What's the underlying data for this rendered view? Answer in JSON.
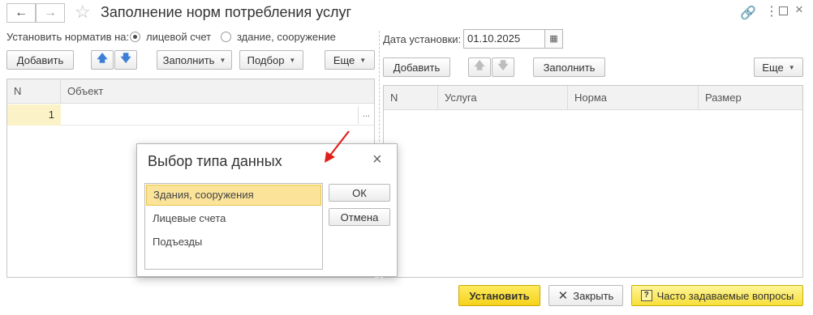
{
  "header": {
    "title": "Заполнение норм потребления услуг"
  },
  "left": {
    "set_label": "Установить норматив на:",
    "radio_account": "лицевой счет",
    "radio_building": "здание, сооружение",
    "add": "Добавить",
    "fill": "Заполнить",
    "pick": "Подбор",
    "more": "Еще",
    "table": {
      "headers": [
        "N",
        "Объект"
      ],
      "rows": [
        {
          "n": "1",
          "object": ""
        }
      ],
      "ellipsis": "..."
    }
  },
  "right": {
    "date_label": "Дата установки:",
    "date_value": "01.10.2025",
    "add": "Добавить",
    "fill": "Заполнить",
    "more": "Еще",
    "table": {
      "headers": [
        "N",
        "Услуга",
        "Норма",
        "Размер"
      ]
    }
  },
  "dialog": {
    "title": "Выбор типа данных",
    "items": [
      "Здания, сооружения",
      "Лицевые счета",
      "Подъезды"
    ],
    "ok": "ОК",
    "cancel": "Отмена"
  },
  "footer": {
    "install": "Установить",
    "close": "Закрыть",
    "faq": "Часто задаваемые вопросы"
  },
  "colors": {
    "accent_yellow": "#f5d21c",
    "selection": "#fbe49a",
    "arrow_red": "#e0211b",
    "up_down_blue": "#3d7fd6"
  }
}
